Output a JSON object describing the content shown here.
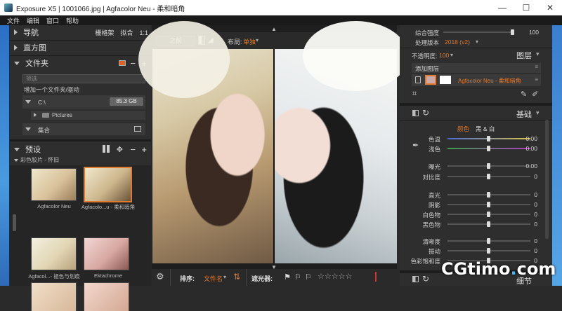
{
  "window": {
    "title": "Exposure X5 | 1001066.jpg | Agfacolor Neu - 柔和暗角",
    "controls": [
      "—",
      "☐",
      "✕"
    ]
  },
  "menu": [
    "文件",
    "编辑",
    "窗口",
    "帮助"
  ],
  "left": {
    "nav": {
      "label": "导航",
      "buttons": [
        "栅格架",
        "拟合",
        "1:1"
      ]
    },
    "histogram": {
      "label": "直方图"
    },
    "folders": {
      "label": "文件夹",
      "search_placeholder": "筛选",
      "add_link": "增加一个文件夹/驱动",
      "drive": {
        "name": "C:\\",
        "size": "85.3 GB"
      },
      "subfolder": "Pictures",
      "collections": "集合"
    },
    "presets": {
      "label": "预设",
      "group": "彩色胶片 - 怀旧",
      "items": [
        {
          "label": "Agfacolor Neu"
        },
        {
          "label": "Agfacolo...u - 柔和暗角"
        },
        {
          "label": "Agfacol...- 褪色与划痕"
        },
        {
          "label": "Ektachrome"
        }
      ]
    }
  },
  "center": {
    "before_button": "之前",
    "layout_label": "布局:",
    "layout_value": "单独",
    "sort_label": "排序:",
    "sort_value": "文件名",
    "filter_label": "遮光器:"
  },
  "right": {
    "top": {
      "mix_label": "综合强度",
      "mix_value": "100",
      "version_label": "处理版本",
      "version_value": "2018 (v2)",
      "opacity_label": "不透明度:",
      "opacity_value": "100",
      "layers_label": "图层",
      "add_layer": "添加图层",
      "layer_name": "Agfacolor Neu - 柔和暗角"
    },
    "basic": {
      "title": "基础",
      "tab_color": "颜色",
      "tab_bw": "黑 & 白",
      "rows": [
        {
          "label": "色温",
          "value": "0.00"
        },
        {
          "label": "浅色",
          "value": "0.00"
        },
        {
          "label": "曝光",
          "value": "0.00"
        },
        {
          "label": "对比度",
          "value": "0"
        },
        {
          "label": "高光",
          "value": "0"
        },
        {
          "label": "阴影",
          "value": "0"
        },
        {
          "label": "白色物",
          "value": "0"
        },
        {
          "label": "黑色物",
          "value": "0"
        },
        {
          "label": "清晰度",
          "value": "0"
        },
        {
          "label": "振动",
          "value": "0"
        },
        {
          "label": "色彩饱和度",
          "value": "0"
        }
      ]
    },
    "details": "细节"
  },
  "watermark": {
    "main": "CGtimo",
    "dot": ".",
    "tail": "com"
  }
}
